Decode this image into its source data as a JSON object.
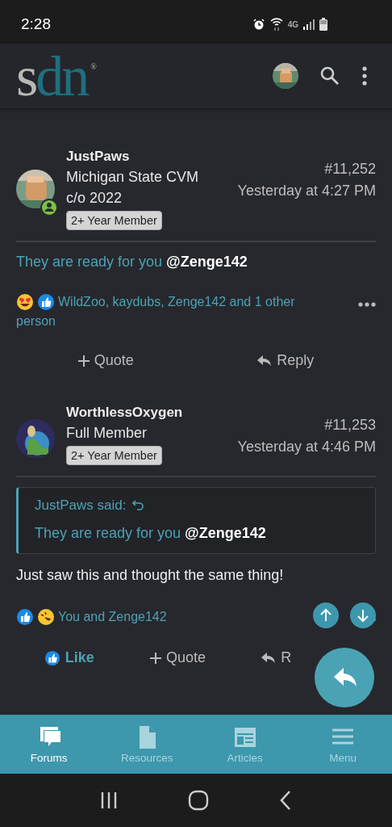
{
  "status_bar": {
    "time": "2:28",
    "network": "4G"
  },
  "header": {
    "logo": {
      "parts": [
        "s",
        "dn"
      ],
      "mark": "®"
    }
  },
  "posts": [
    {
      "author": "JustPaws",
      "title_lines": [
        "Michigan State CVM",
        "c/o 2022"
      ],
      "badge": "2+ Year Member",
      "online": true,
      "number": "#11,252",
      "time": "Yesterday at 4:27 PM",
      "message": "They are ready for you **@Zenge142**",
      "reactions": {
        "emojis": [
          {
            "kind": "love"
          },
          {
            "kind": "like"
          }
        ],
        "text": "WildZoo, kaydubs, Zenge142 and 1 other person"
      },
      "actions": [
        {
          "kind": "quote",
          "label": "Quote"
        },
        {
          "kind": "reply",
          "label": "Reply"
        }
      ]
    },
    {
      "author": "WorthlessOxygen",
      "title_lines": [
        "Full Member"
      ],
      "badge": "2+ Year Member",
      "online": false,
      "number": "#11,253",
      "time": "Yesterday at 4:46 PM",
      "quote": {
        "author": "JustPaws said:",
        "text": "They are ready for you **@Zenge142**"
      },
      "message": "Just saw this and thought the same thing!",
      "reactions": {
        "emojis": [
          {
            "kind": "like"
          },
          {
            "kind": "laugh"
          }
        ],
        "text": "You and Zenge142"
      },
      "actions": [
        {
          "kind": "like",
          "label": "Like",
          "active": true
        },
        {
          "kind": "quote",
          "label": "Quote"
        },
        {
          "kind": "reply",
          "label": "R"
        }
      ]
    }
  ],
  "bottom_nav": [
    {
      "label": "Forums",
      "selected": true
    },
    {
      "label": "Resources",
      "selected": false
    },
    {
      "label": "Articles",
      "selected": false
    },
    {
      "label": "Menu",
      "selected": false
    }
  ]
}
